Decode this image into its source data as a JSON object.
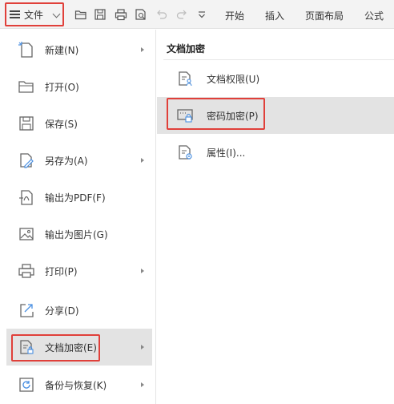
{
  "toolbar": {
    "file_label": "文件",
    "tabs": [
      "开始",
      "插入",
      "页面布局",
      "公式"
    ]
  },
  "menu": {
    "items": [
      {
        "label": "新建(N)",
        "icon": "new-doc-icon",
        "submenu": true
      },
      {
        "label": "打开(O)",
        "icon": "folder-open-icon",
        "submenu": false
      },
      {
        "label": "保存(S)",
        "icon": "save-icon",
        "submenu": false
      },
      {
        "label": "另存为(A)",
        "icon": "save-as-icon",
        "submenu": true
      },
      {
        "label": "输出为PDF(F)",
        "icon": "export-pdf-icon",
        "submenu": false
      },
      {
        "label": "输出为图片(G)",
        "icon": "export-image-icon",
        "submenu": false
      },
      {
        "label": "打印(P)",
        "icon": "print-icon",
        "submenu": true
      },
      {
        "label": "分享(D)",
        "icon": "share-icon",
        "submenu": false
      },
      {
        "label": "文档加密(E)",
        "icon": "document-encrypt-icon",
        "submenu": true
      },
      {
        "label": "备份与恢复(K)",
        "icon": "backup-restore-icon",
        "submenu": true
      }
    ],
    "active_index": 8
  },
  "panel": {
    "title": "文档加密",
    "items": [
      {
        "label": "文档权限(U)",
        "icon": "document-permission-icon"
      },
      {
        "label": "密码加密(P)",
        "icon": "password-encrypt-icon"
      },
      {
        "label": "属性(I)...",
        "icon": "properties-icon"
      }
    ],
    "active_index": 1
  },
  "colors": {
    "highlight_border": "#e0403a",
    "active_bg": "#e3e3e3",
    "toolbar_bg": "#f3f3f3"
  }
}
